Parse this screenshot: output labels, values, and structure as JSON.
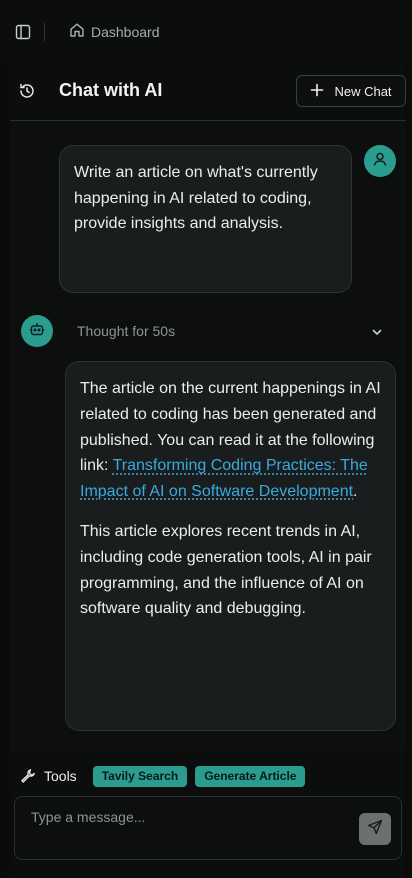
{
  "topbar": {
    "breadcrumb_label": "Dashboard"
  },
  "header": {
    "title": "Chat with AI",
    "new_chat_label": "New Chat"
  },
  "messages": {
    "user_text": "Write an article on what's currently happening in AI related to coding, provide insights and analysis.",
    "thought_label": "Thought for",
    "thought_duration": "50s",
    "bot_paragraph1": "The article on the current happenings in AI related to coding has been generated and published. You can read it at the following link:",
    "bot_link_text": "Transforming Coding Practices: The Impact of AI on Software Development",
    "bot_period": ".",
    "bot_paragraph2": "This article explores recent trends in AI, including code generation tools, AI in pair programming, and the influence of AI on software quality and debugging."
  },
  "tools": {
    "label": "Tools",
    "items": [
      "Tavily Search",
      "Generate Article"
    ]
  },
  "composer": {
    "placeholder": "Type a message..."
  },
  "colors": {
    "accent": "#2a9d8f",
    "link": "#3aa9e0",
    "background": "#0c0d0d",
    "bubble": "#1a1d1d"
  },
  "icons": {
    "sidebar_toggle": "sidebar-icon",
    "home": "home-icon",
    "history": "history-icon",
    "plus": "plus-icon",
    "user": "user-icon",
    "bot": "bot-icon",
    "chevron": "chevron-down-icon",
    "wrench": "wrench-icon",
    "send": "send-icon"
  }
}
